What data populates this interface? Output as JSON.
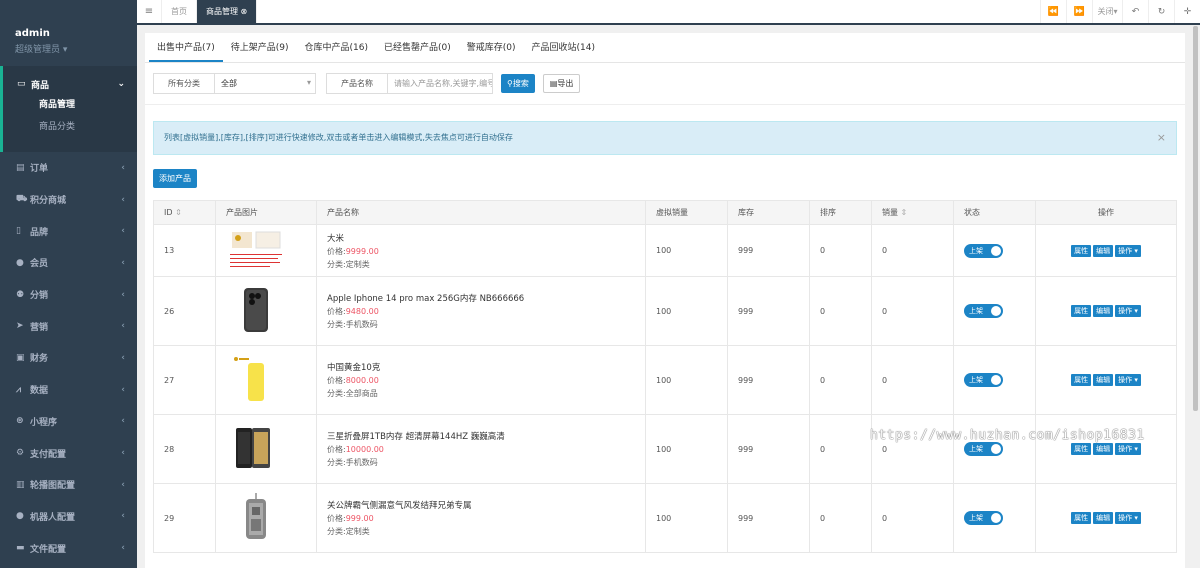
{
  "user": {
    "name": "admin",
    "role": "超级管理员"
  },
  "sidebar": {
    "open": {
      "label": "商品",
      "subs": [
        "商品管理",
        "商品分类"
      ]
    },
    "items": [
      {
        "label": "订单",
        "icon": "file-icon"
      },
      {
        "label": "积分商城",
        "icon": "cart-icon"
      },
      {
        "label": "品牌",
        "icon": "tablet-icon"
      },
      {
        "label": "会员",
        "icon": "user-icon"
      },
      {
        "label": "分销",
        "icon": "users-icon"
      },
      {
        "label": "营销",
        "icon": "send-icon"
      },
      {
        "label": "财务",
        "icon": "money-icon"
      },
      {
        "label": "数据",
        "icon": "chart-icon"
      },
      {
        "label": "小程序",
        "icon": "mini-program-icon"
      },
      {
        "label": "支付配置",
        "icon": "cogs-icon"
      },
      {
        "label": "轮播图配置",
        "icon": "slides-icon"
      },
      {
        "label": "机器人配置",
        "icon": "robot-icon"
      },
      {
        "label": "文件配置",
        "icon": "folder-icon"
      }
    ]
  },
  "topbar": {
    "tabs": [
      "首页",
      "商品管理"
    ],
    "close_label": "关闭"
  },
  "product_tabs": [
    "出售中产品(7)",
    "待上架产品(9)",
    "仓库中产品(16)",
    "已经售罄产品(0)",
    "警戒库存(0)",
    "产品回收站(14)"
  ],
  "filter": {
    "category_label": "所有分类",
    "category_value": "全部",
    "name_label": "产品名称",
    "name_placeholder": "请输入产品名称,关键字,编号",
    "search_label": "搜索",
    "export_label": "导出"
  },
  "alert_text": "列表[虚拟销量],[库存],[排序]可进行快速修改,双击或者单击进入编辑模式,失去焦点可进行自动保存",
  "add_label": "添加产品",
  "columns": [
    "ID",
    "产品图片",
    "产品名称",
    "虚拟销量",
    "库存",
    "排序",
    "销量",
    "状态",
    "操作"
  ],
  "rows": [
    {
      "id": "13",
      "name": "大米",
      "price": "9999.00",
      "cat": "定制类",
      "vsales": "100",
      "stock": "999",
      "sort": "0",
      "sales": "0",
      "thumb": "doc"
    },
    {
      "id": "26",
      "name": "Apple Iphone 14 pro max 256G内存 NB666666",
      "price": "9480.00",
      "cat": "手机数码",
      "vsales": "100",
      "stock": "999",
      "sort": "0",
      "sales": "0",
      "thumb": "phone"
    },
    {
      "id": "27",
      "name": "中国黄金10克",
      "price": "8000.00",
      "cat": "全部商品",
      "vsales": "100",
      "stock": "999",
      "sort": "0",
      "sales": "0",
      "thumb": "gold"
    },
    {
      "id": "28",
      "name": "三星折叠屏1TB内存 超清屏幕144HZ 巍巍高清",
      "price": "10000.00",
      "cat": "手机数码",
      "vsales": "100",
      "stock": "999",
      "sort": "0",
      "sales": "0",
      "thumb": "fold"
    },
    {
      "id": "29",
      "name": "关公牌霸气侧漏意气风发结拜兄弟专属",
      "price": "999.00",
      "cat": "定制类",
      "vsales": "100",
      "stock": "999",
      "sort": "0",
      "sales": "0",
      "thumb": "pendant"
    }
  ],
  "labels": {
    "price_prefix": "价格:",
    "cat_prefix": "分类:",
    "status_on": "上架",
    "op_attr": "属性",
    "op_edit": "编辑",
    "op_more": "操作"
  },
  "watermark": "https://www.huzhan.com/ishop16831"
}
